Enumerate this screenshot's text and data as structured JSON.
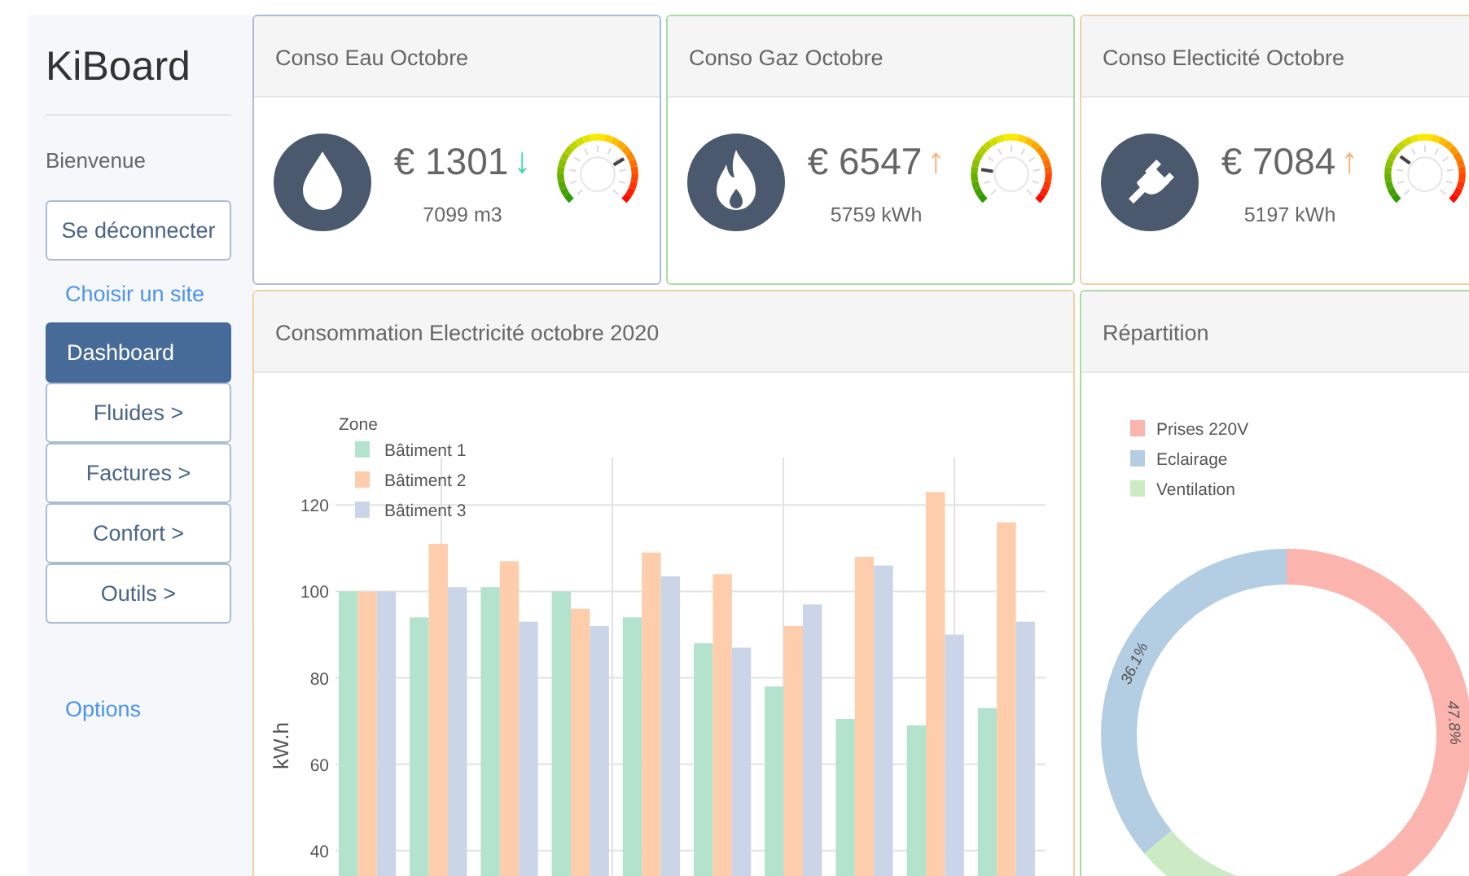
{
  "sidebar": {
    "brand": "KiBoard",
    "greeting": "Bienvenue",
    "logout": "Se déconnecter",
    "site_link": "Choisir un site",
    "items": [
      {
        "label": "Dashboard",
        "selected": true
      },
      {
        "label": "Fluides >",
        "selected": false
      },
      {
        "label": "Factures >",
        "selected": false
      },
      {
        "label": "Confort >",
        "selected": false
      },
      {
        "label": "Outils >",
        "selected": false
      }
    ],
    "options": "Options"
  },
  "kpi_cards": [
    {
      "title": "Conso Eau Octobre",
      "kind": "water",
      "color": "#a9bcd8",
      "amount": "€ 1301",
      "arrow": {
        "text": "↓",
        "color": "#3ddbb0"
      },
      "quantity": "7099 m3"
    },
    {
      "title": "Conso Gaz Octobre",
      "kind": "gas",
      "color": "#a9dca3",
      "amount": "€ 6547",
      "arrow": {
        "text": "↑",
        "color": "#f7b07a"
      },
      "quantity": "5759 kWh"
    },
    {
      "title": "Conso Electicité Octobre",
      "kind": "plug",
      "color": "#f3cfa6",
      "amount": "€ 7084",
      "arrow": {
        "text": "↑",
        "color": "#f7b07a"
      },
      "quantity": "5197 kWh"
    }
  ],
  "consumption_panel": {
    "title": "Consommation Electricité octobre 2020",
    "color": "#f3cfa6",
    "chart_data": {
      "type": "bar",
      "ylabel": "kW.h",
      "grid": true,
      "legend": {
        "title": "Zone"
      },
      "ylim": [
        33,
        131
      ],
      "yticks": [
        40,
        60,
        80,
        100,
        120
      ],
      "series": [
        {
          "name": "Bâtiment 1",
          "color": "#b3e2cd",
          "values": [
            100,
            94,
            101,
            100,
            94,
            88,
            78,
            70.5,
            69,
            73
          ]
        },
        {
          "name": "Bâtiment 2",
          "color": "#fdcdac",
          "values": [
            100,
            111,
            107,
            96,
            109,
            104,
            92,
            108,
            123,
            116
          ]
        },
        {
          "name": "Bâtiment 3",
          "color": "#cbd5e8",
          "values": [
            100,
            101,
            93,
            92,
            103.5,
            87,
            97,
            106,
            90,
            93
          ]
        }
      ]
    }
  },
  "split_panel": {
    "title": "Répartition",
    "color": "#a9dca3",
    "chart_data": {
      "type": "donut",
      "legend": true,
      "categories": [
        "Prises 220V",
        "Eclairage",
        "Ventilation"
      ],
      "series": [
        {
          "values": [
            47.8,
            36.1,
            16.1
          ]
        }
      ],
      "value_labels": [
        "47.8%",
        "36.1%",
        null
      ],
      "colors": [
        "#fbb4ae",
        "#b3cde3",
        "#ccebc5"
      ]
    }
  }
}
